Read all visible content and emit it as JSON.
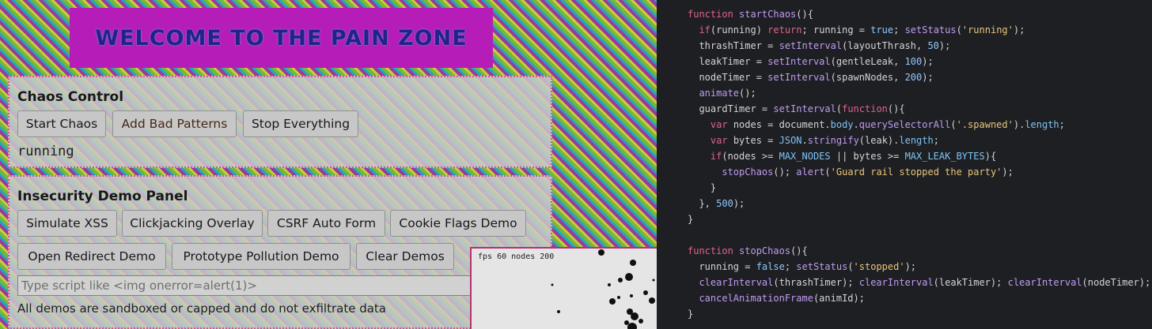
{
  "banner": {
    "title": "WELCOME TO THE PAIN ZONE"
  },
  "chaos_panel": {
    "title": "Chaos Control",
    "buttons": [
      "Start Chaos",
      "Add Bad Patterns",
      "Stop Everything"
    ],
    "status": "running"
  },
  "insecurity_panel": {
    "title": "Insecurity Demo Panel",
    "buttons_row1": [
      "Simulate XSS",
      "Clickjacking Overlay",
      "CSRF Auto Form",
      "Cookie Flags Demo"
    ],
    "buttons_row2": [
      "Open Redirect Demo",
      "Prototype Pollution Demo",
      "Clear Demos"
    ],
    "input_placeholder": "Type script like <img onerror=alert(1)>",
    "note": "All demos are sandboxed or capped and do not exfiltrate data"
  },
  "hud": {
    "readout": "fps 60 nodes 200"
  },
  "code": {
    "lines": [
      "function startChaos(){",
      "  if(running) return; running = true; setStatus('running');",
      "  thrashTimer = setInterval(layoutThrash, 50);",
      "  leakTimer = setInterval(gentleLeak, 100);",
      "  nodeTimer = setInterval(spawnNodes, 200);",
      "  animate();",
      "  guardTimer = setInterval(function(){",
      "    var nodes = document.body.querySelectorAll('.spawned').length;",
      "    var bytes = JSON.stringify(leak).length;",
      "    if(nodes >= MAX_NODES || bytes >= MAX_LEAK_BYTES){",
      "      stopChaos(); alert('Guard rail stopped the party');",
      "    }",
      "  }, 500);",
      "}",
      "",
      "function stopChaos(){",
      "  running = false; setStatus('stopped');",
      "  clearInterval(thrashTimer); clearInterval(leakTimer); clearInterval(nodeTimer);",
      "  cancelAnimationFrame(animId);",
      "}"
    ]
  },
  "colors": {
    "banner_bg": "#c21ec4",
    "banner_text": "#27268c",
    "panel_border": "#e35aa0",
    "editor_bg": "#1e1f23",
    "keyword": "#e0628a",
    "function": "#bf9cf0",
    "string": "#e8c57a",
    "number": "#8fc7ff"
  }
}
